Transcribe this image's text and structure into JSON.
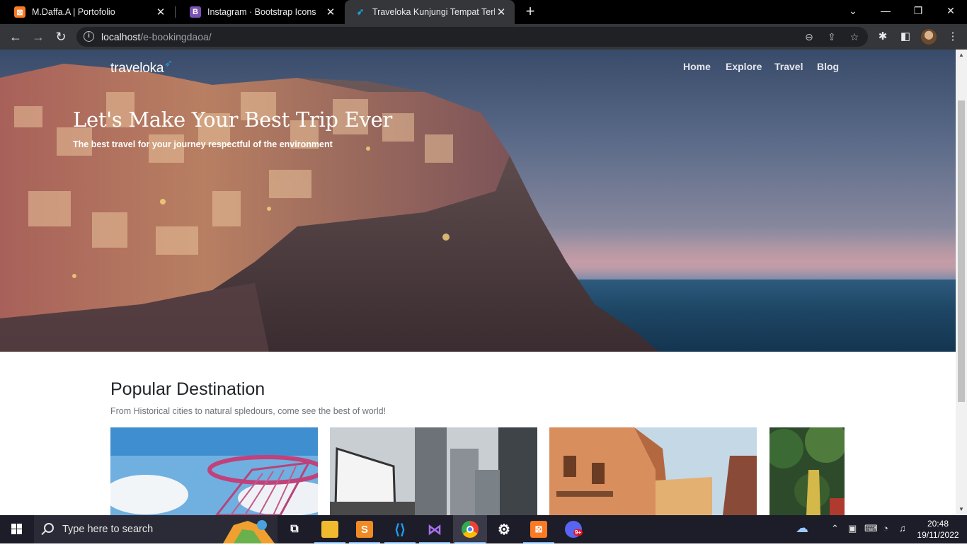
{
  "browser": {
    "tabs": [
      {
        "title": "M.Daffa.A | Portofolio",
        "favicon": "xampp-icon",
        "color": "#fb7a24"
      },
      {
        "title": "Instagram · Bootstrap Icons",
        "favicon": "bootstrap-icon",
        "letter": "B",
        "color": "#7952b3"
      },
      {
        "title": "Traveloka Kunjungi Tempat Terbu",
        "favicon": "traveloka-icon",
        "color": "#1ba0e2"
      }
    ],
    "url_host": "localhost",
    "url_path": "/e-bookingdaoa/"
  },
  "page": {
    "logo": "traveloka",
    "nav": [
      "Home",
      "Explore",
      "Travel",
      "Blog"
    ],
    "hero_title": "Let's Make Your Best Trip Ever",
    "hero_subtitle": "The best travel for your journey respectful of the environment",
    "section_title": "Popular Destination",
    "section_subtitle": "From Historical cities to natural spledours, come see the best of world!",
    "cards": [
      "singapore-gardens-photo",
      "city-billboard-photo",
      "italian-houses-photo",
      "jungle-statue-photo"
    ]
  },
  "taskbar": {
    "search_placeholder": "Type here to search",
    "time": "20:48",
    "date": "19/11/2022",
    "apps": [
      "task-view-icon",
      "file-explorer-icon",
      "sublime-text-icon",
      "vscode-icon",
      "visual-studio-icon",
      "chrome-icon",
      "settings-icon",
      "xampp-icon",
      "discord-icon"
    ],
    "discord_badge": "9+"
  }
}
